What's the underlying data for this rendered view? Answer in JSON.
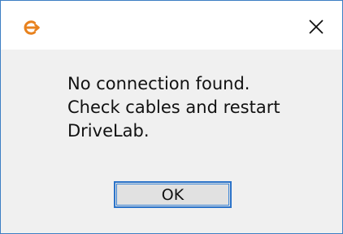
{
  "dialog": {
    "app_icon": "drivelab-logo-icon",
    "close_icon": "close-icon",
    "message_lines": [
      "No connection found.",
      "Check cables and restart",
      "DriveLab."
    ],
    "ok_label": "OK"
  },
  "colors": {
    "accent": "#e8821e",
    "border": "#3d7fc4",
    "button_focus": "#2b73c9",
    "body_bg": "#f0f0f0",
    "title_bg": "#ffffff"
  }
}
